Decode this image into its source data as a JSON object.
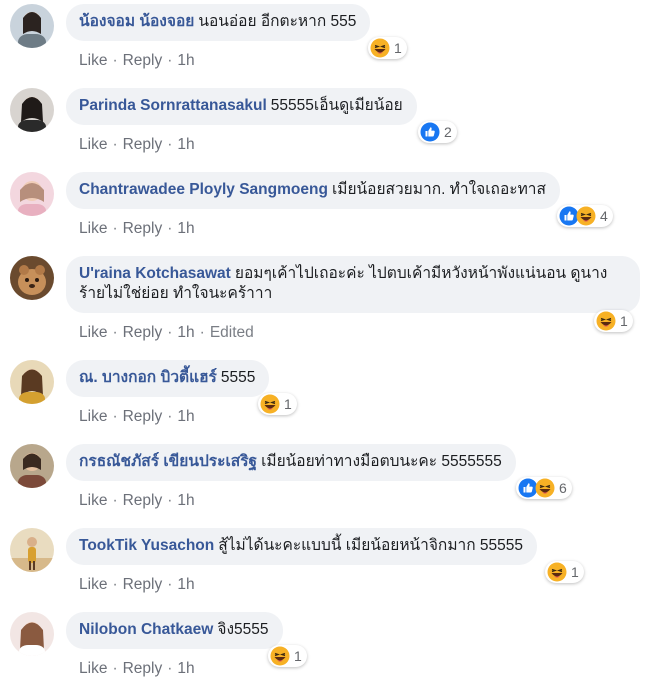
{
  "actions": {
    "like": "Like",
    "reply": "Reply",
    "separator": "·"
  },
  "colors": {
    "author": "#385898",
    "bubble": "#f0f2f5",
    "like_blue": "#1877f2",
    "haha_yellow": "#f7b125"
  },
  "comments": [
    {
      "author": "น้องจอม น้องจอย",
      "text": "นอนอ่อย อีกตะหาก 555",
      "time": "1h",
      "edited": "",
      "reactions": [
        "haha-icon"
      ],
      "reaction_count": "1"
    },
    {
      "author": "Parinda Sornrattanasakul",
      "text": "55555เอ็นดูเมียน้อย",
      "time": "1h",
      "edited": "",
      "reactions": [
        "like-icon"
      ],
      "reaction_count": "2"
    },
    {
      "author": "Chantrawadee Ployly Sangmoeng",
      "text": "เมียน้อยสวยมาก. ทำใจเถอะทาส",
      "time": "1h",
      "edited": "",
      "reactions": [
        "like-icon",
        "haha-icon"
      ],
      "reaction_count": "4"
    },
    {
      "author": "U'raina Kotchasawat",
      "text": "ยอมๆเค้าไปเถอะค่ะ ไปตบเค้ามีหวังหน้าพังแน่นอน ดูนางร้ายไม่ใช่ย่อย ทำใจนะคร้าาา",
      "time": "1h",
      "edited": "Edited",
      "reactions": [
        "haha-icon"
      ],
      "reaction_count": "1"
    },
    {
      "author": "ณ. บางกอก บิวตี้แฮร์",
      "text": "5555",
      "time": "1h",
      "edited": "",
      "reactions": [
        "haha-icon"
      ],
      "reaction_count": "1"
    },
    {
      "author": "กรธณัชภัสร์ เขียนประเสริฐ",
      "text": "เมียน้อยท่าทางมือตบนะคะ 5555555",
      "time": "1h",
      "edited": "",
      "reactions": [
        "like-icon",
        "haha-icon"
      ],
      "reaction_count": "6"
    },
    {
      "author": "TookTik Yusachon",
      "text": "สู้ไม่ได้นะคะแบบนี้ เมียน้อยหน้าจิกมาก 55555",
      "time": "1h",
      "edited": "",
      "reactions": [
        "haha-icon"
      ],
      "reaction_count": "1"
    },
    {
      "author": "Nilobon Chatkaew",
      "text": "จิง5555",
      "time": "1h",
      "edited": "",
      "reactions": [
        "haha-icon"
      ],
      "reaction_count": "1"
    }
  ]
}
